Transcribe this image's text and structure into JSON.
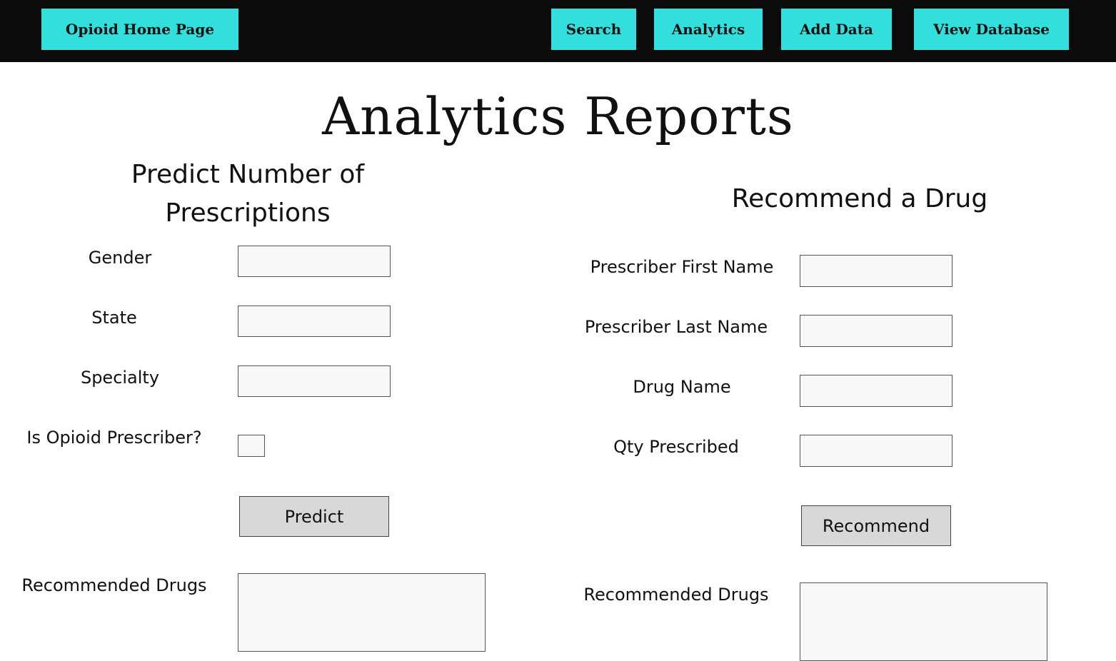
{
  "nav": {
    "home_label": "Opioid Home Page",
    "search_label": "Search",
    "analytics_label": "Analytics",
    "add_data_label": "Add Data",
    "view_database_label": "View Database"
  },
  "page_title": "Analytics Reports",
  "predict": {
    "title_line1": "Predict Number of",
    "title_line2": "Prescriptions",
    "gender_label": "Gender",
    "gender_value": "",
    "state_label": "State",
    "state_value": "",
    "specialty_label": "Specialty",
    "specialty_value": "",
    "opioid_label": "Is Opioid Prescriber?",
    "opioid_checked": false,
    "button_label": "Predict",
    "result_label": "Recommended Drugs",
    "result_value": ""
  },
  "recommend": {
    "title": "Recommend a Drug",
    "first_name_label": "Prescriber First Name",
    "first_name_value": "",
    "last_name_label": "Prescriber Last Name",
    "last_name_value": "",
    "drug_name_label": "Drug Name",
    "drug_name_value": "",
    "qty_label": "Qty Prescribed",
    "qty_value": "",
    "button_label": "Recommend",
    "result_label": "Recommended Drugs",
    "result_value": ""
  },
  "colors": {
    "nav_background": "#0b0b0b",
    "nav_button": "#33dfdc",
    "field_background": "#f8f8f8",
    "action_button": "#d8d8d8"
  }
}
